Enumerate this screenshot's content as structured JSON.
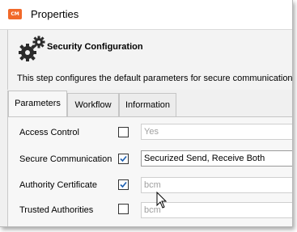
{
  "window": {
    "app_icon_text": "CM",
    "title": "Properties",
    "accent_color": "#f1692a"
  },
  "header": {
    "icon": "gears-icon",
    "section_title": "Security Configuration",
    "description": "This step configures the default parameters for secure communication"
  },
  "tabs": [
    {
      "label": "Parameters",
      "active": true
    },
    {
      "label": "Workflow",
      "active": false
    },
    {
      "label": "Information",
      "active": false
    }
  ],
  "parameters": {
    "rows": [
      {
        "label": "Access Control",
        "checked": false,
        "value": "Yes",
        "enabled": false
      },
      {
        "label": "Secure Communication",
        "checked": true,
        "value": "Securized Send, Receive Both",
        "enabled": true
      },
      {
        "label": "Authority Certificate",
        "checked": true,
        "value": "bcm",
        "enabled": false
      },
      {
        "label": "Trusted Authorities",
        "checked": false,
        "value": "bcm",
        "enabled": false
      }
    ]
  }
}
